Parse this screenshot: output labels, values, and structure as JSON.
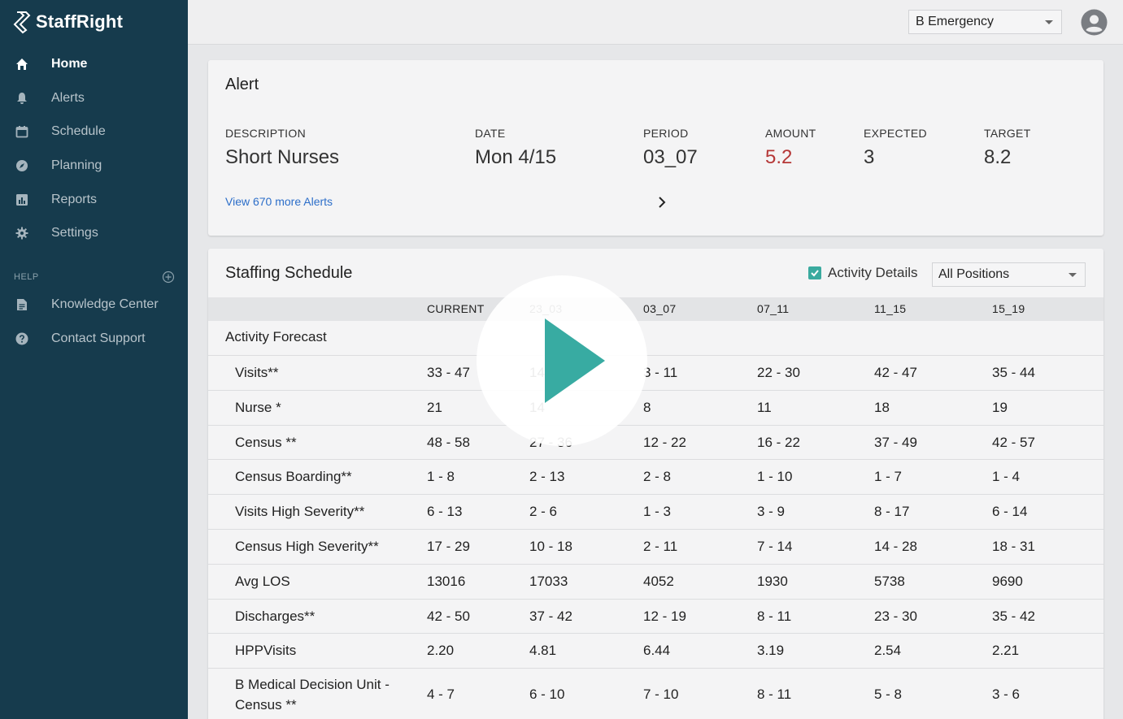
{
  "brand": {
    "name": "StaffRight"
  },
  "sidebar": {
    "items": [
      {
        "label": "Home",
        "icon": "home-icon",
        "active": true
      },
      {
        "label": "Alerts",
        "icon": "bell-icon"
      },
      {
        "label": "Schedule",
        "icon": "calendar-icon"
      },
      {
        "label": "Planning",
        "icon": "compass-icon"
      },
      {
        "label": "Reports",
        "icon": "bar-chart-icon"
      },
      {
        "label": "Settings",
        "icon": "gear-icon"
      }
    ],
    "help_heading": "HELP",
    "help_items": [
      {
        "label": "Knowledge Center",
        "icon": "document-icon"
      },
      {
        "label": "Contact Support",
        "icon": "question-icon"
      }
    ]
  },
  "topbar": {
    "department": "B Emergency"
  },
  "alert": {
    "title": "Alert",
    "columns": [
      {
        "heading": "DESCRIPTION",
        "value": "Short Nurses"
      },
      {
        "heading": "DATE",
        "value": "Mon 4/15"
      },
      {
        "heading": "PERIOD",
        "value": "03_07"
      },
      {
        "heading": "AMOUNT",
        "value": "5.2"
      },
      {
        "heading": "EXPECTED",
        "value": "3"
      },
      {
        "heading": "TARGET",
        "value": "8.2"
      }
    ],
    "more_link": "View 670 more Alerts"
  },
  "schedule": {
    "title": "Staffing Schedule",
    "activity_details": "Activity Details",
    "activity_checked": true,
    "position_filter": "All Positions",
    "headers": [
      "CURRENT",
      "23_03",
      "03_07",
      "07_11",
      "11_15",
      "15_19"
    ],
    "section": "Activity Forecast",
    "rows": [
      {
        "label": "Visits**",
        "values": [
          "33 - 47",
          "14",
          "3 - 11",
          "22 - 30",
          "42 - 47",
          "35 - 44"
        ]
      },
      {
        "label": "Nurse *",
        "values": [
          "21",
          "14",
          "8",
          "11",
          "18",
          "19"
        ]
      },
      {
        "label": "Census **",
        "values": [
          "48 - 58",
          "27 - 36",
          "12 - 22",
          "16 - 22",
          "37 - 49",
          "42 - 57"
        ]
      },
      {
        "label": "Census Boarding**",
        "values": [
          "1 - 8",
          "2 - 13",
          "2 - 8",
          "1 - 10",
          "1 - 7",
          "1 - 4"
        ]
      },
      {
        "label": "Visits High Severity**",
        "values": [
          "6 - 13",
          "2 - 6",
          "1 - 3",
          "3 - 9",
          "8 - 17",
          "6 - 14"
        ]
      },
      {
        "label": "Census High Severity**",
        "values": [
          "17 - 29",
          "10 - 18",
          "2 - 11",
          "7 - 14",
          "14 - 28",
          "18 - 31"
        ]
      },
      {
        "label": "Avg LOS",
        "values": [
          "13016",
          "17033",
          "4052",
          "1930",
          "5738",
          "9690"
        ]
      },
      {
        "label": "Discharges**",
        "values": [
          "42 - 50",
          "37 - 42",
          "12 - 19",
          "8 - 11",
          "23 - 30",
          "35 - 42"
        ]
      },
      {
        "label": "HPPVisits",
        "values": [
          "2.20",
          "4.81",
          "6.44",
          "3.19",
          "2.54",
          "2.21"
        ]
      },
      {
        "label": "B Medical Decision Unit - Census **",
        "values": [
          "4 - 7",
          "6 - 10",
          "7 - 10",
          "8 - 11",
          "5 - 8",
          "3 - 6"
        ]
      }
    ]
  },
  "colors": {
    "sidebar": "#163b4d",
    "accent": "#38aba2",
    "alert_red": "#b53737",
    "link": "#2c6ec9"
  }
}
